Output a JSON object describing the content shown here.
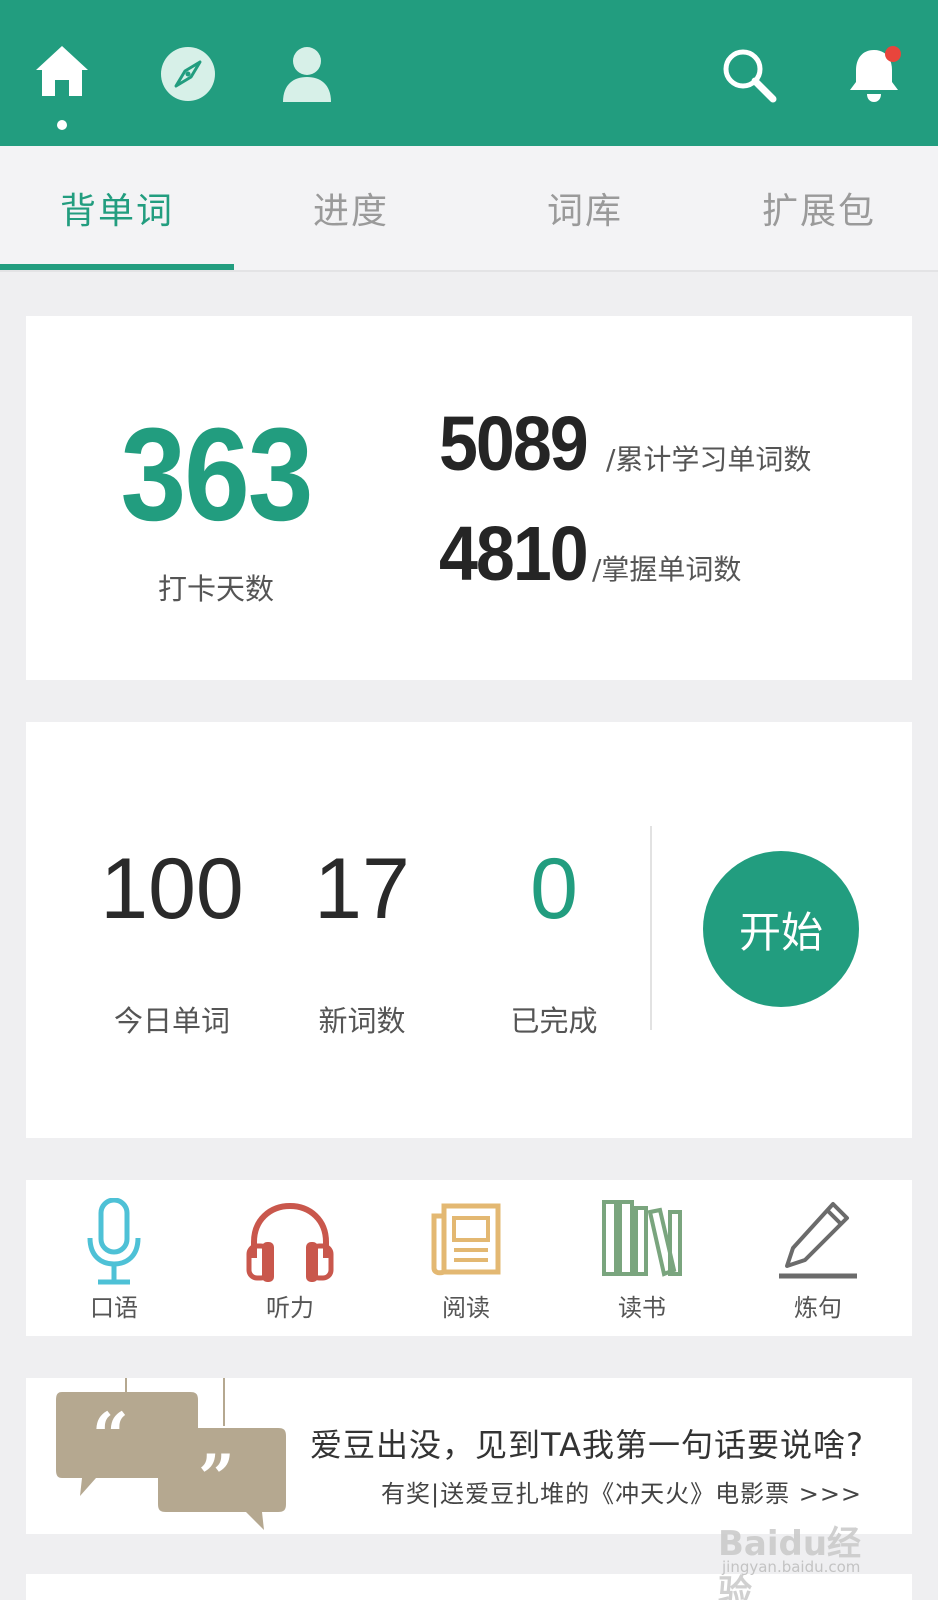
{
  "topbar": {
    "icons": [
      "home-icon",
      "compass-icon",
      "user-icon",
      "search-icon",
      "bell-icon"
    ],
    "accent": "#229d7f",
    "notification_color": "#e8453c"
  },
  "tabs": [
    {
      "label": "背单词",
      "active": true
    },
    {
      "label": "进度",
      "active": false
    },
    {
      "label": "词库",
      "active": false
    },
    {
      "label": "扩展包",
      "active": false
    }
  ],
  "summary": {
    "checkin_days": "363",
    "checkin_label": "打卡天数",
    "total_learned": "5089",
    "total_learned_label": "/累计学习单词数",
    "mastered": "4810",
    "mastered_label": "/掌握单词数"
  },
  "today": {
    "today_words": "100",
    "today_words_label": "今日单词",
    "new_words": "17",
    "new_words_label": "新词数",
    "completed": "0",
    "completed_label": "已完成",
    "start_label": "开始"
  },
  "features": [
    {
      "label": "口语",
      "icon": "microphone-icon",
      "color": "#4ec1d6"
    },
    {
      "label": "听力",
      "icon": "headphones-icon",
      "color": "#c9574c"
    },
    {
      "label": "阅读",
      "icon": "newspaper-icon",
      "color": "#e3b872"
    },
    {
      "label": "读书",
      "icon": "books-icon",
      "color": "#7aa57e"
    },
    {
      "label": "炼句",
      "icon": "pencil-icon",
      "color": "#6b6b6b"
    }
  ],
  "banner": {
    "title": "爱豆出没，见到TA我第一句话要说啥?",
    "subtitle": "有奖|送爱豆扎堆的《冲天火》电影票 >>>",
    "icon": "quote-bubbles-icon"
  },
  "watermark": {
    "text": "Baidu经验",
    "url_text": "jingyan.baidu.com"
  }
}
